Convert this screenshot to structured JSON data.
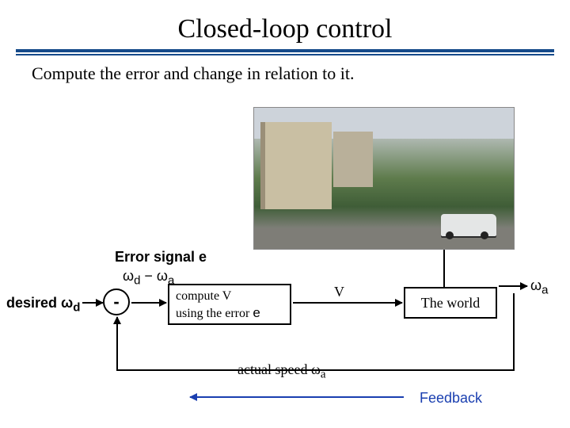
{
  "title": "Closed-loop control",
  "subtitle": "Compute the error and change in relation to it.",
  "error_label": "Error signal e",
  "error_formula_html": "ω<sub>d</sub> − ω<sub>a</sub>",
  "desired_html": "desired ω<sub>d</sub>",
  "minus": "-",
  "compute_line1": "compute  V",
  "compute_line2_prefix": "using the error ",
  "compute_line2_e": "e",
  "v_label": "V",
  "world_label": "The world",
  "omega_a_out_html": "ω<sub>a</sub>",
  "actual_speed_html": "actual speed ω<sub>a</sub>",
  "feedback": "Feedback",
  "photo_alt": "Lombard Street winding road with van"
}
